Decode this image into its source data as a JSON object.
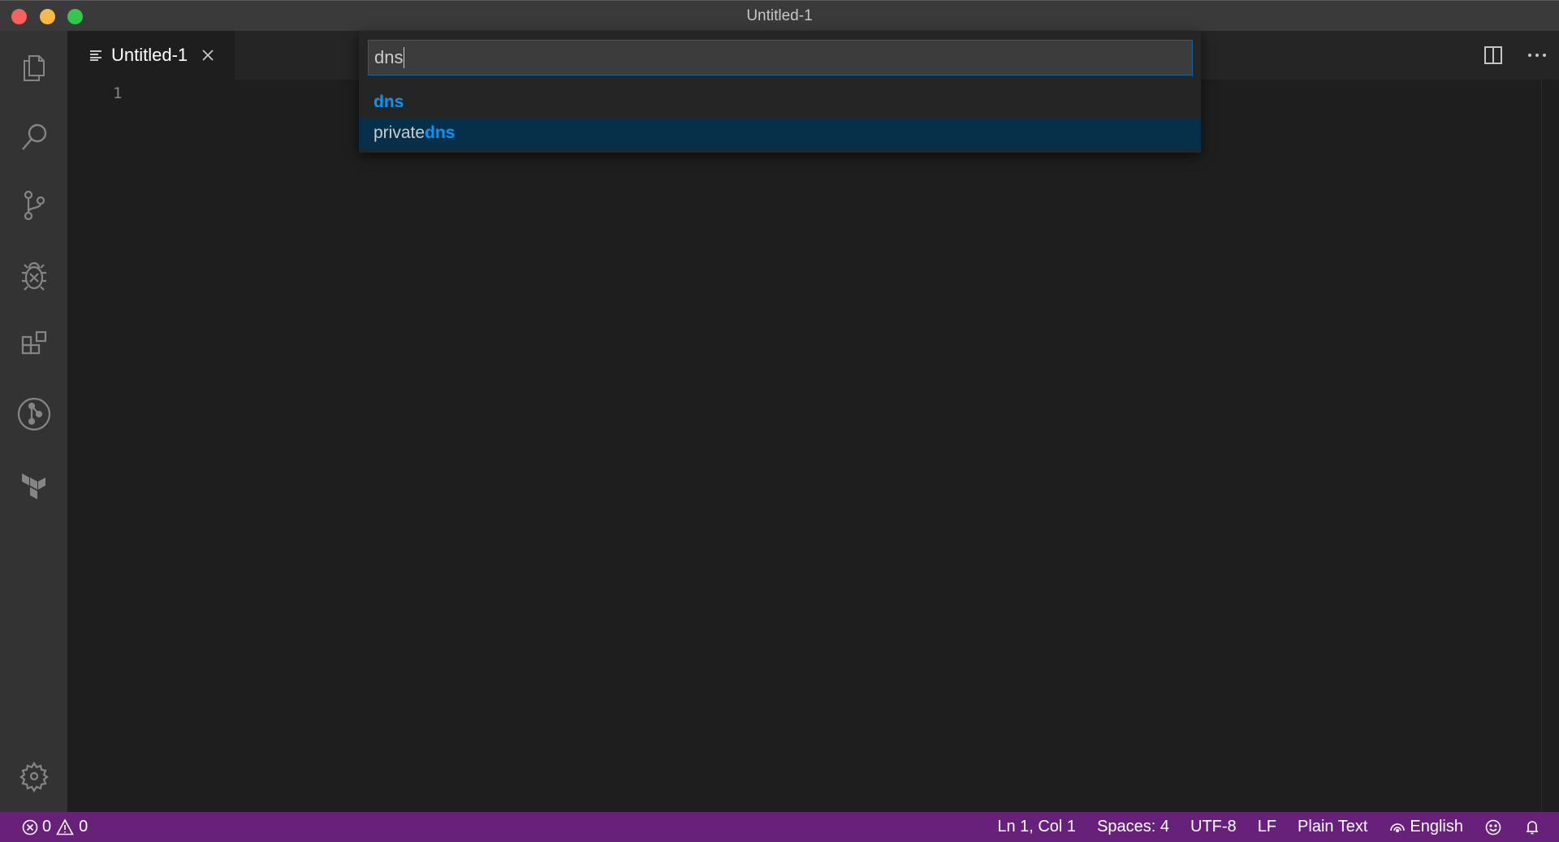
{
  "window": {
    "title": "Untitled-1"
  },
  "activity_bar": {
    "items": [
      {
        "name": "explorer",
        "icon": "files-icon"
      },
      {
        "name": "search",
        "icon": "search-icon"
      },
      {
        "name": "source-control",
        "icon": "source-control-icon"
      },
      {
        "name": "debug",
        "icon": "debug-icon"
      },
      {
        "name": "extensions",
        "icon": "extensions-icon"
      },
      {
        "name": "gitlens",
        "icon": "git-graph-icon"
      },
      {
        "name": "terraform",
        "icon": "terraform-icon"
      }
    ],
    "bottom": {
      "name": "manage",
      "icon": "gear-icon"
    }
  },
  "tabs": [
    {
      "label": "Untitled-1",
      "icon": "plain-text-file-icon",
      "active": true
    }
  ],
  "editor_actions": {
    "split": "split-editor-icon",
    "more": "more-actions-icon"
  },
  "editor": {
    "line_numbers": [
      "1"
    ]
  },
  "quick_pick": {
    "input_value": "dns",
    "items": [
      {
        "prefix": "",
        "match": "dns",
        "selected": false
      },
      {
        "prefix": "private",
        "match": "dns",
        "selected": true
      }
    ]
  },
  "status_bar": {
    "errors": "0",
    "warnings": "0",
    "cursor": "Ln 1, Col 1",
    "indent": "Spaces: 4",
    "encoding": "UTF-8",
    "eol": "LF",
    "language": "Plain Text",
    "spell_language": "English",
    "colors": {
      "background": "#68217a"
    }
  }
}
